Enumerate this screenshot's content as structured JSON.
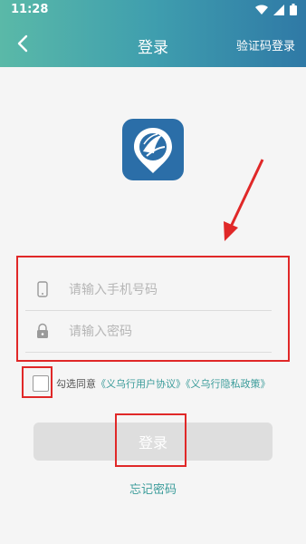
{
  "status_bar": {
    "time": "11:28"
  },
  "header": {
    "title": "登录",
    "right_action": "验证码登录"
  },
  "form": {
    "phone_placeholder": "请输入手机号码",
    "password_placeholder": "请输入密码"
  },
  "agreement": {
    "prefix": "勾选同意",
    "user_agreement": "《义乌行用户协议》",
    "privacy_policy": "《义乌行隐私政策》",
    "checked": false
  },
  "login_button": "登录",
  "forgot_password": "忘记密码",
  "colors": {
    "header_start": "#5ab9a8",
    "header_end": "#2f79a6",
    "link": "#3b9c9a",
    "annotation_red": "#e02828"
  }
}
